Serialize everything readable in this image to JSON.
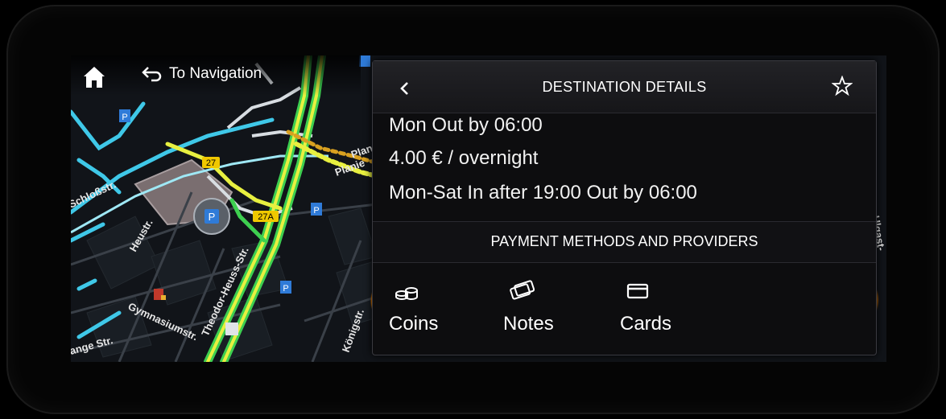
{
  "topbar": {
    "home_icon": "home-icon",
    "back_label": "To Navigation"
  },
  "map": {
    "street_labels": [
      "Schloßstr.",
      "Heustr.",
      "Gymnasiumstr.",
      "Theodor-Heuss-Str.",
      "Planie",
      "Plan",
      "Königstr.",
      "Ulgast-",
      "ange Str."
    ],
    "route_badges": [
      "27",
      "27A"
    ],
    "parking_symbol": "P"
  },
  "panel": {
    "title": "DESTINATION DETAILS",
    "lines": [
      "Mon Out by 06:00",
      "4.00 € / overnight",
      "Mon-Sat In after 19:00 Out by 06:00"
    ],
    "section_title": "PAYMENT METHODS AND PROVIDERS",
    "payment_methods": [
      {
        "label": "Coins",
        "icon": "coins-icon"
      },
      {
        "label": "Notes",
        "icon": "banknotes-icon"
      },
      {
        "label": "Cards",
        "icon": "card-icon"
      }
    ]
  },
  "colors": {
    "route_yellow": "#e8f040",
    "route_green": "#3ecf50",
    "street_cyan": "#3fc8e8",
    "parking_blue": "#2f7bd8",
    "accent_orange": "#ff9a20"
  }
}
